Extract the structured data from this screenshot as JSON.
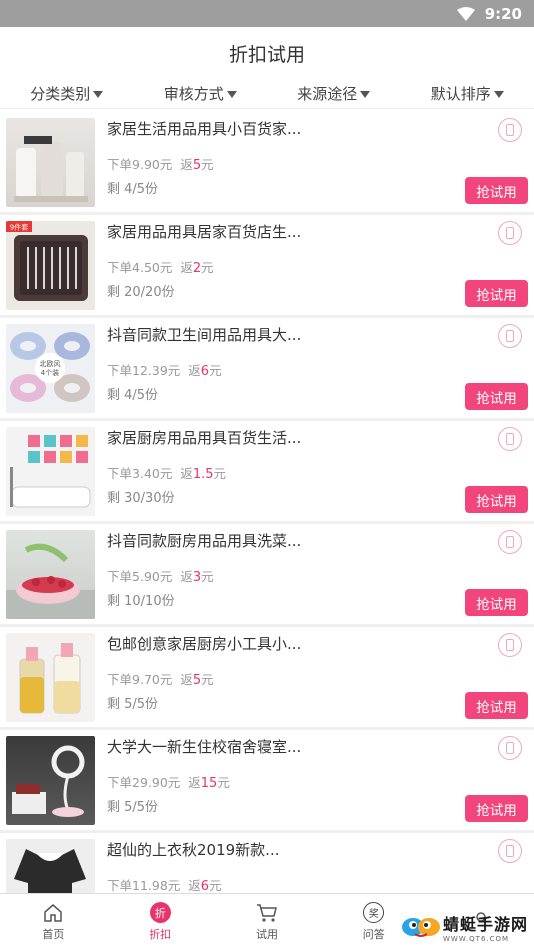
{
  "status": {
    "time": "9:20"
  },
  "header": {
    "title": "折扣试用"
  },
  "filters": [
    "分类类别",
    "审核方式",
    "来源途径",
    "默认排序"
  ],
  "items": [
    {
      "title": "家居生活用品用具小百货家...",
      "price_prefix": "下单",
      "price": "9.90元",
      "return_prefix": "返",
      "return_amount": "5",
      "return_unit": "元",
      "remain": "剩 4/5份",
      "button": "抢试用"
    },
    {
      "title": "家居用品用具居家百货店生...",
      "price_prefix": "下单",
      "price": "4.50元",
      "return_prefix": "返",
      "return_amount": "2",
      "return_unit": "元",
      "remain": "剩 20/20份",
      "button": "抢试用",
      "badge": "9件套"
    },
    {
      "title": "抖音同款卫生间用品用具大...",
      "price_prefix": "下单",
      "price": "12.39元",
      "return_prefix": "返",
      "return_amount": "6",
      "return_unit": "元",
      "remain": "剩 4/5份",
      "button": "抢试用",
      "badge": "北欧风\n4个装"
    },
    {
      "title": "家居厨房用品用具百货生活...",
      "price_prefix": "下单",
      "price": "3.40元",
      "return_prefix": "返",
      "return_amount": "1.5",
      "return_unit": "元",
      "remain": "剩 30/30份",
      "button": "抢试用"
    },
    {
      "title": "抖音同款厨房用品用具洗菜...",
      "price_prefix": "下单",
      "price": "5.90元",
      "return_prefix": "返",
      "return_amount": "3",
      "return_unit": "元",
      "remain": "剩 10/10份",
      "button": "抢试用"
    },
    {
      "title": "包邮创意家居厨房小工具小...",
      "price_prefix": "下单",
      "price": "9.70元",
      "return_prefix": "返",
      "return_amount": "5",
      "return_unit": "元",
      "remain": "剩 5/5份",
      "button": "抢试用"
    },
    {
      "title": "大学大一新生住校宿舍寝室...",
      "price_prefix": "下单",
      "price": "29.90元",
      "return_prefix": "返",
      "return_amount": "15",
      "return_unit": "元",
      "remain": "剩 5/5份",
      "button": "抢试用"
    },
    {
      "title": "超仙的上衣秋2019新款...",
      "price_prefix": "下单",
      "price": "11.98元",
      "return_prefix": "返",
      "return_amount": "6",
      "return_unit": "元",
      "remain": "",
      "button": ""
    }
  ],
  "tabbar": [
    {
      "label": "首页",
      "icon": "home-icon"
    },
    {
      "label": "折扣",
      "icon": "discount-icon",
      "glyph": "折"
    },
    {
      "label": "试用",
      "icon": "cart-icon"
    },
    {
      "label": "问答",
      "icon": "qa-icon",
      "glyph": "奖"
    },
    {
      "label": "",
      "icon": "user-icon"
    }
  ],
  "watermark": {
    "main": "蜻蜓手游网",
    "sub": "WWW.QT6.COM"
  },
  "colors": {
    "accent": "#f2457b",
    "status_bar": "#9e9e9e"
  }
}
